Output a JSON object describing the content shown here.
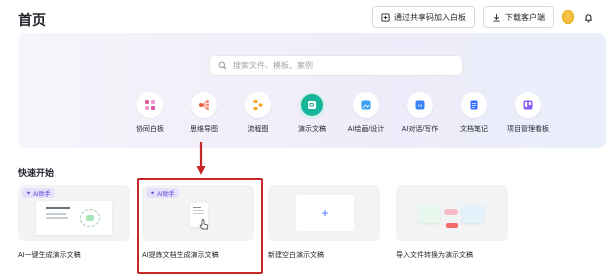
{
  "header": {
    "title": "首页",
    "join_board_label": "通过共享码加入白板",
    "download_label": "下载客户端"
  },
  "search": {
    "placeholder": "搜索文件、模板、案例"
  },
  "tools": [
    {
      "label": "协同白板",
      "icon": "whiteboard-icon",
      "color": "#e05aa0"
    },
    {
      "label": "思维导图",
      "icon": "mindmap-icon",
      "color": "#f0563d"
    },
    {
      "label": "流程图",
      "icon": "flowchart-icon",
      "color": "#f5a623"
    },
    {
      "label": "演示文稿",
      "icon": "presentation-icon",
      "color": "#18b49a"
    },
    {
      "label": "AI绘画/设计",
      "icon": "ai-paint-icon",
      "color": "#3aa0f5"
    },
    {
      "label": "AI对话/写作",
      "icon": "ai-chat-icon",
      "color": "#3b82f6"
    },
    {
      "label": "文档笔记",
      "icon": "doc-note-icon",
      "color": "#3370ff"
    },
    {
      "label": "项目管理看板",
      "icon": "kanban-icon",
      "color": "#8b5cf6"
    }
  ],
  "quick_start": {
    "title": "快速开始",
    "cards": [
      {
        "label": "AI一键生成演示文稿",
        "badge": "AI助手"
      },
      {
        "label": "AI提炼文档生成演示文稿",
        "badge": "AI助手"
      },
      {
        "label": "新建空白演示文稿",
        "plus": "+"
      },
      {
        "label": "导入文件转换为演示文稿"
      }
    ]
  },
  "colors": {
    "accent": "#3370ff",
    "highlight": "#c62828",
    "active_tool": "#18b49a"
  }
}
